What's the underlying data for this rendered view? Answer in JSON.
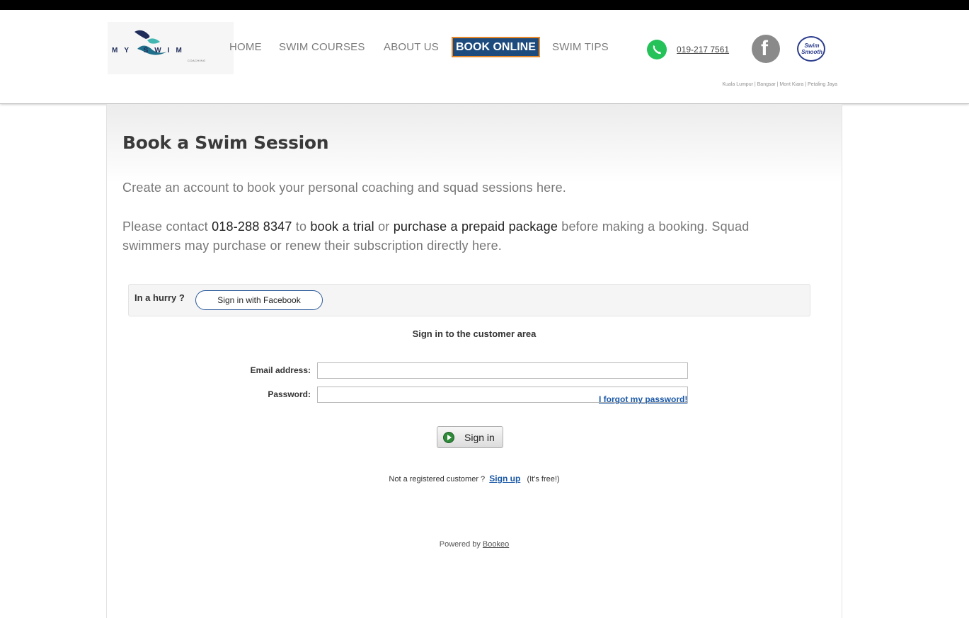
{
  "header": {
    "logo_word": "MY SWIM",
    "logo_sub": "COACHING",
    "nav": [
      {
        "label": "HOME"
      },
      {
        "label": "SWIM COURSES"
      },
      {
        "label": "ABOUT US"
      },
      {
        "label": "BOOK ONLINE"
      },
      {
        "label": "SWIM TIPS"
      }
    ],
    "phone": "019-217 7561",
    "facebook_glyph": "f",
    "swimsmooth_label": "Swim Smooth",
    "locations": "Kuala Lumpur | Bangsar | Mont Kiara | Petaling Jaya",
    "book_bg": "#1e4b7e",
    "book_border": "#e8892c"
  },
  "main": {
    "title": "Book a Swim Session",
    "intro": "Create an account to book your personal coaching and squad sessions here.",
    "para_1": "Please contact ",
    "contact_phone": "018-288 8347",
    "para_2": " to ",
    "trial_link": "book a trial",
    "para_3": " or ",
    "package_link": "purchase a prepaid package",
    "para_4": " before making a booking. Squad swimmers may purchase or renew their subscription directly here."
  },
  "login": {
    "hurry_label": "In a hurry ?",
    "facebook_button": "Sign in with Facebook",
    "title": "Sign in to the customer area",
    "email_label": "Email address:",
    "email_value": "",
    "password_label": "Password:",
    "password_value": "",
    "forgot_link": "I forgot my password!",
    "signin_button": "Sign in",
    "not_registered": "Not a registered customer ?",
    "signup_link": "Sign up",
    "free_note": "(It's free!)",
    "powered_by": "Powered by",
    "bookeo_link": "Bookeo"
  }
}
